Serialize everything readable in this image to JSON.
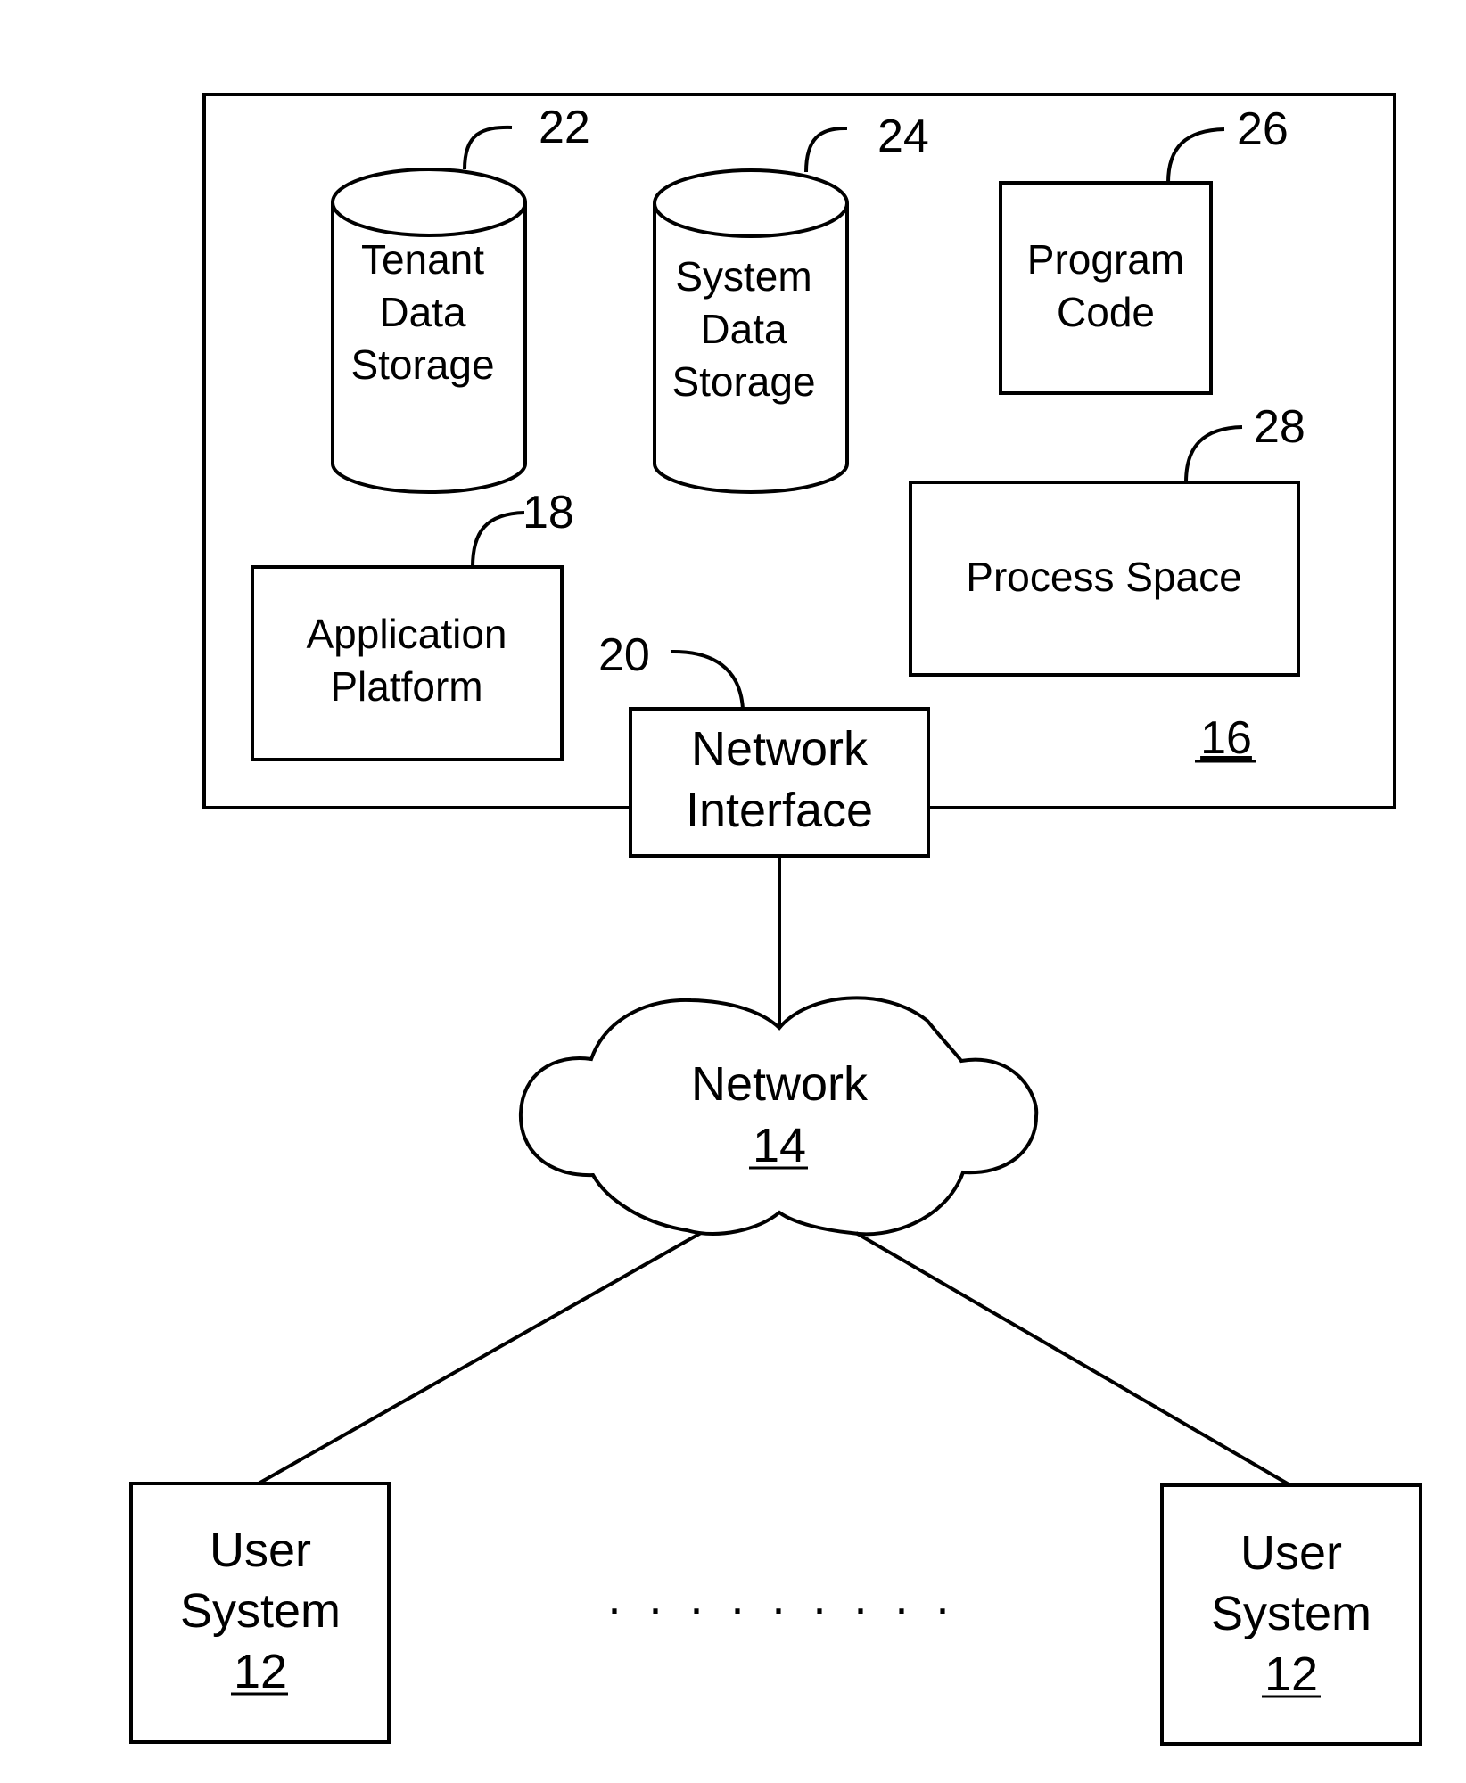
{
  "diagram": {
    "system": {
      "ref": "16"
    },
    "tenant_storage": {
      "lines": [
        "Tenant",
        "Data",
        "Storage"
      ],
      "ref": "22"
    },
    "system_storage": {
      "lines": [
        "System",
        "Data",
        "Storage"
      ],
      "ref": "24"
    },
    "program_code": {
      "lines": [
        "Program",
        "Code"
      ],
      "ref": "26"
    },
    "process_space": {
      "lines": [
        "Process Space"
      ],
      "ref": "28"
    },
    "app_platform": {
      "lines": [
        "Application",
        "Platform"
      ],
      "ref": "18"
    },
    "network_interface": {
      "lines": [
        "Network",
        "Interface"
      ],
      "ref": "20"
    },
    "network": {
      "label": "Network",
      "ref": "14"
    },
    "user_system_left": {
      "lines": [
        "User",
        "System"
      ],
      "ref": "12"
    },
    "user_system_right": {
      "lines": [
        "User",
        "System"
      ],
      "ref": "12"
    },
    "ellipsis": ". . . . . . . . ."
  }
}
